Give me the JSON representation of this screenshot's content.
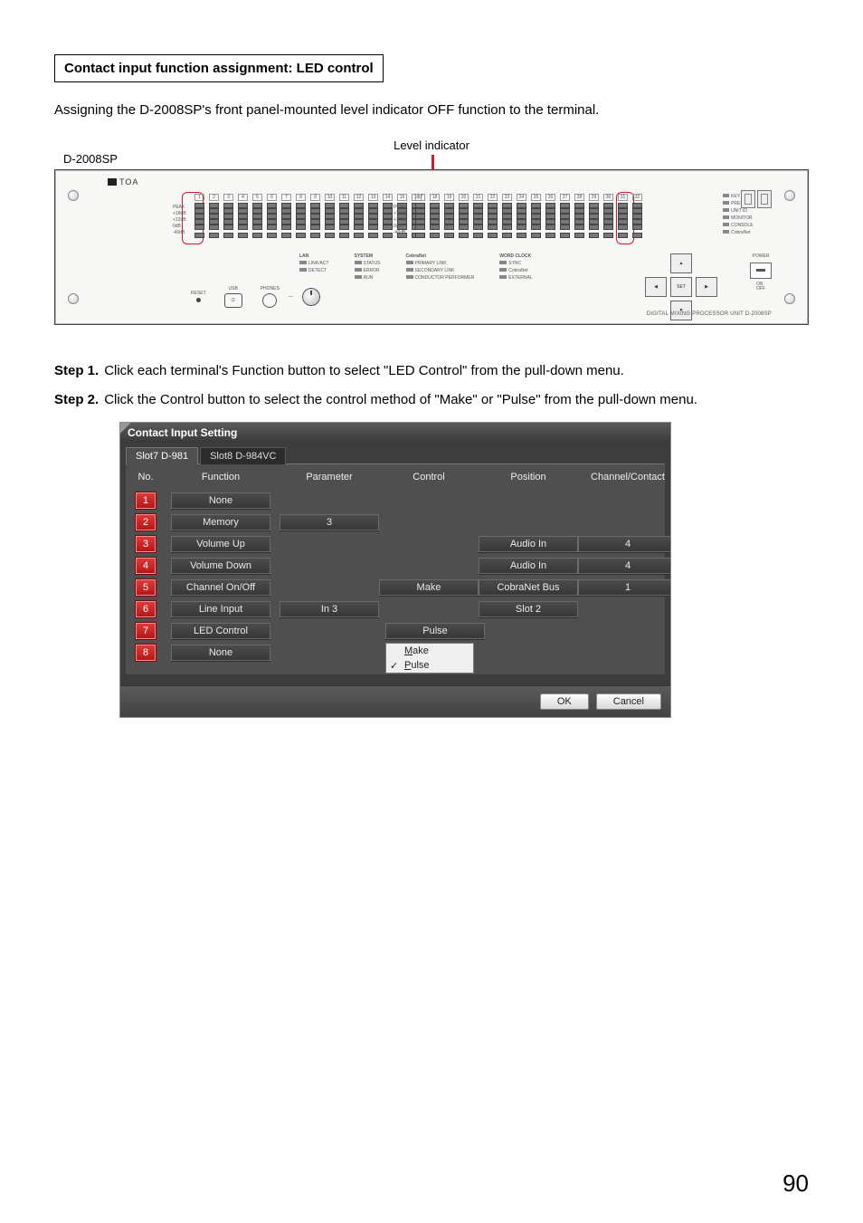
{
  "heading": "Contact input function assignment: LED control",
  "intro": "Assigning the D-2008SP's front panel-mounted level indicator OFF function to the terminal.",
  "device_label": "D-2008SP",
  "hw": {
    "top_label": "Level indicator",
    "logo": "TOA",
    "channel_numbers_left": [
      "1",
      "2",
      "3",
      "4",
      "5",
      "6",
      "7",
      "8",
      "9",
      "10",
      "11",
      "12",
      "13",
      "14",
      "15",
      "16"
    ],
    "channel_numbers_right": [
      "17",
      "18",
      "19",
      "20",
      "21",
      "22",
      "23",
      "24",
      "25",
      "26",
      "27",
      "28",
      "29",
      "30",
      "31",
      "32"
    ],
    "level_labels": [
      "PEAK",
      "+18dB",
      "+12dB",
      "0dB",
      "-40dB"
    ],
    "monitor_label": "DATA\nMONITOR",
    "status_group_lan_title": "LAN",
    "status_group_system_title": "SYSTEM",
    "status_group_cobranet_title": "CobraNet",
    "status_group_wordclock_title": "WORD CLOCK",
    "status_lan": [
      "LINK/ACT",
      "DETECT"
    ],
    "status_system": [
      "STATUS",
      "ERROR",
      "RUN"
    ],
    "status_cobranet": [
      "PRIMARY LINK",
      "SECONDARY LINK",
      "CONDUCTOR PERFORMER"
    ],
    "status_wordclock": [
      "SYNC",
      "CobraNet",
      "EXTERNAL"
    ],
    "right_lamps": [
      "KEY LOCK",
      "PRESET",
      "UNIT ID",
      "MONITOR",
      "CONSOLE",
      "CobraNet"
    ],
    "sel_label": "SET",
    "power_label": "POWER",
    "power_onoff": "ON\nOFF",
    "reset_label": "RESET",
    "usb_label": "USB",
    "phones_label": "PHONES",
    "product_line": "DIGITAL MIXING PROCESSOR UNIT D-2008SP"
  },
  "steps": {
    "s1_label": "Step 1.",
    "s1_text": "Click each terminal's Function button to select \"LED Control\" from the pull-down menu.",
    "s2_label": "Step 2.",
    "s2_text": "Click the Control button to select the control method of \"Make\" or \"Pulse\" from the pull-down menu."
  },
  "cis": {
    "title": "Contact Input Setting",
    "tabs": [
      "Slot7 D-981",
      "Slot8 D-984VC"
    ],
    "columns": [
      "No.",
      "Function",
      "Parameter",
      "Control",
      "Position",
      "Channel/Contact"
    ],
    "rows": [
      {
        "no": "1",
        "function": "None"
      },
      {
        "no": "2",
        "function": "Memory",
        "parameter": "3"
      },
      {
        "no": "3",
        "function": "Volume Up",
        "position": "Audio In",
        "channel": "4"
      },
      {
        "no": "4",
        "function": "Volume Down",
        "position": "Audio In",
        "channel": "4"
      },
      {
        "no": "5",
        "function": "Channel On/Off",
        "control": "Make",
        "position": "CobraNet Bus",
        "channel": "1"
      },
      {
        "no": "6",
        "function": "Line Input",
        "parameter": "In 3",
        "position": "Slot 2"
      },
      {
        "no": "7",
        "function": "LED Control",
        "control": "Pulse"
      },
      {
        "no": "8",
        "function": "None"
      }
    ],
    "dropdown": {
      "items": [
        "Make",
        "Pulse"
      ],
      "checked": "Pulse"
    },
    "ok": "OK",
    "cancel": "Cancel"
  },
  "page_number": "90"
}
